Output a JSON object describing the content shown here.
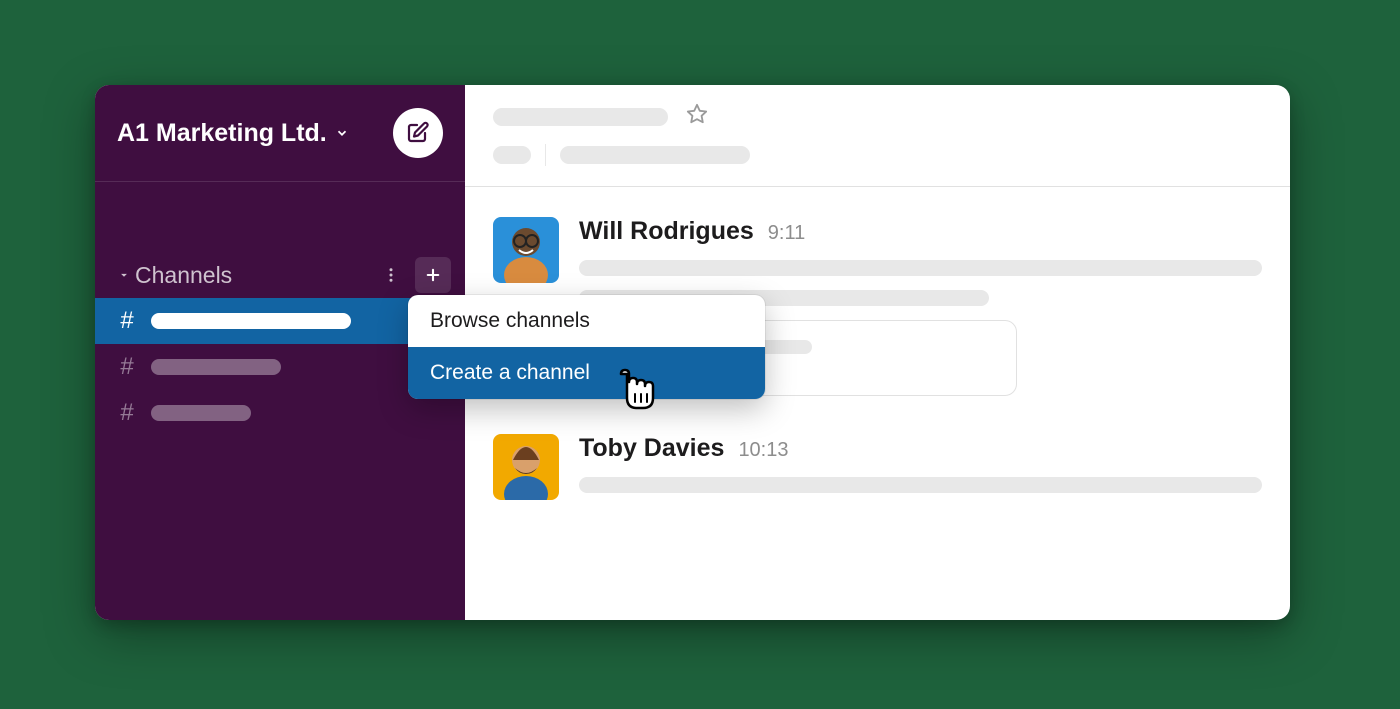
{
  "workspace": {
    "name": "A1 Marketing Ltd."
  },
  "sidebar": {
    "section_label": "Channels",
    "channels": [
      {
        "active": true
      },
      {
        "active": false
      },
      {
        "active": false
      }
    ]
  },
  "menu": {
    "items": [
      {
        "label": "Browse channels",
        "selected": false
      },
      {
        "label": "Create a channel",
        "selected": true
      }
    ]
  },
  "messages": [
    {
      "author": "Will Rodrigues",
      "time": "9:11",
      "avatar_bg": "#2a90d9"
    },
    {
      "author": "Toby Davies",
      "time": "10:13",
      "avatar_bg": "#f2a900"
    }
  ]
}
